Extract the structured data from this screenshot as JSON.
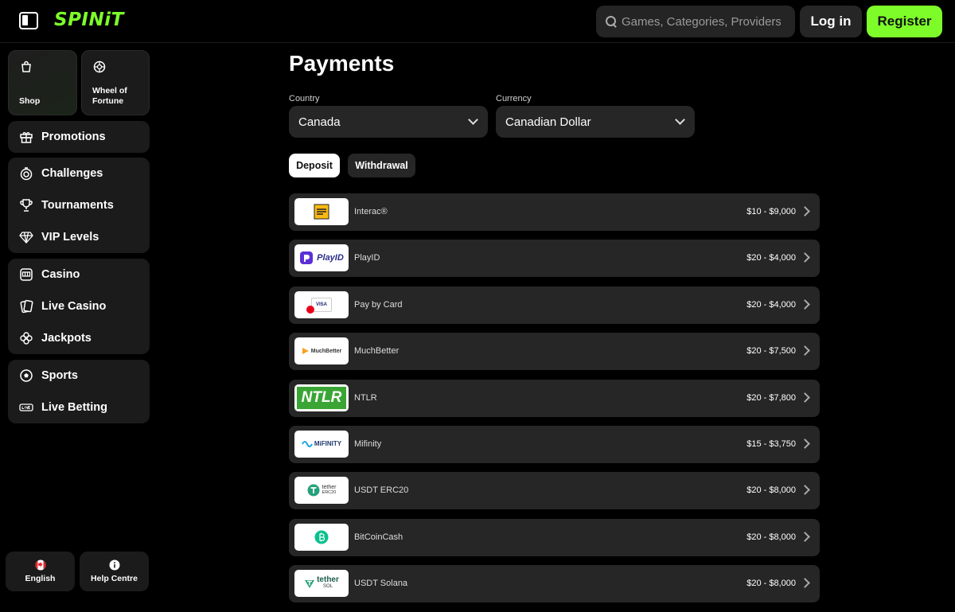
{
  "header": {
    "brand": "SPINiT",
    "search_placeholder": "Games, Categories, Providers",
    "login_label": "Log in",
    "register_label": "Register"
  },
  "sidebar": {
    "tiles": [
      {
        "label": "Shop",
        "icon": "shopping-bag-icon"
      },
      {
        "label": "Wheel of Fortune",
        "icon": "wheel-icon"
      }
    ],
    "groups": [
      [
        {
          "label": "Promotions",
          "icon": "gift-icon"
        }
      ],
      [
        {
          "label": "Challenges",
          "icon": "target-icon"
        },
        {
          "label": "Tournaments",
          "icon": "trophy-icon"
        },
        {
          "label": "VIP Levels",
          "icon": "diamond-icon"
        }
      ],
      [
        {
          "label": "Casino",
          "icon": "slot-machine-icon"
        },
        {
          "label": "Live Casino",
          "icon": "cards-icon"
        },
        {
          "label": "Jackpots",
          "icon": "clover-icon"
        }
      ],
      [
        {
          "label": "Sports",
          "icon": "soccer-ball-icon"
        },
        {
          "label": "Live Betting",
          "icon": "live-icon"
        }
      ]
    ],
    "language_label": "English",
    "help_label": "Help Centre"
  },
  "main": {
    "title": "Payments",
    "country_label": "Country",
    "country_value": "Canada",
    "currency_label": "Currency",
    "currency_value": "Canadian Dollar",
    "tabs": {
      "deposit": "Deposit",
      "withdrawal": "Withdrawal"
    },
    "methods": [
      {
        "name": "Interac®",
        "range": "$10 - $9,000",
        "logo": "interac-logo"
      },
      {
        "name": "PlayID",
        "range": "$20 - $4,000",
        "logo": "playid-logo",
        "logo_text": "PlayID"
      },
      {
        "name": "Pay by Card",
        "range": "$20 - $4,000",
        "logo": "card-logo",
        "logo_text": "VISA"
      },
      {
        "name": "MuchBetter",
        "range": "$20 - $7,500",
        "logo": "muchbetter-logo",
        "logo_text": "MuchBetter"
      },
      {
        "name": "NTLR",
        "range": "$20 - $7,800",
        "logo": "ntlr-logo",
        "logo_text": "NTLR"
      },
      {
        "name": "Mifinity",
        "range": "$15 - $3,750",
        "logo": "mifinity-logo",
        "logo_text": "MiFINITY"
      },
      {
        "name": "USDT ERC20",
        "range": "$20 - $8,000",
        "logo": "tether-erc20-logo",
        "logo_text": "tether",
        "logo_sub": "ERC20"
      },
      {
        "name": "BitCoinCash",
        "range": "$20 - $8,000",
        "logo": "bitcoincash-logo"
      },
      {
        "name": "USDT Solana",
        "range": "$20 - $8,000",
        "logo": "tether-sol-logo",
        "logo_text": "tether",
        "logo_sub": "SOL"
      }
    ]
  },
  "colors": {
    "accent": "#7dfc2a",
    "surface": "#262626",
    "sidebar": "#1b1b1b"
  }
}
